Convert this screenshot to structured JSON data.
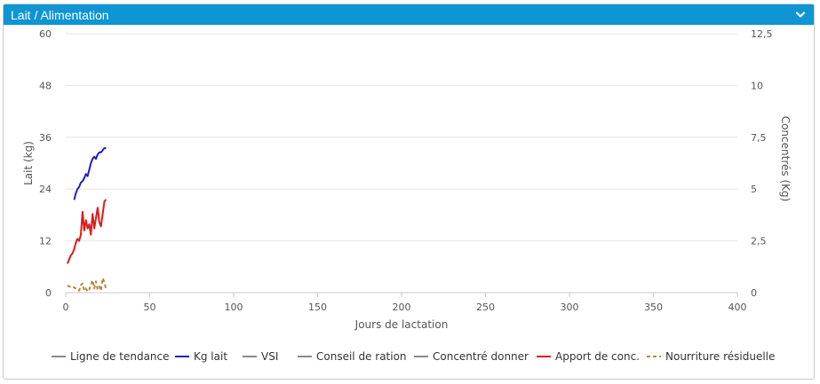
{
  "panel": {
    "title": "Lait / Alimentation"
  },
  "colors": {
    "header": "#0e95d3",
    "kg_lait": "#1f1fbf",
    "apport": "#e01a1a",
    "nourriture": "#b08a3a",
    "neutral": "#8a8a8a"
  },
  "chart_data": {
    "type": "line",
    "xlabel": "Jours de lactation",
    "ylabel_left": "Lait (kg)",
    "ylabel_right": "Concentrés (Kg)",
    "xlim": [
      0,
      400
    ],
    "ylim_left": [
      0,
      60
    ],
    "ylim_right": [
      0,
      12.5
    ],
    "x_ticks": [
      "0",
      "50",
      "100",
      "150",
      "200",
      "250",
      "300",
      "350",
      "400"
    ],
    "y_left_ticks": [
      "0",
      "12",
      "24",
      "36",
      "48",
      "60"
    ],
    "y_right_ticks": [
      "0",
      "2,5",
      "5",
      "7,5",
      "10",
      "12,5"
    ],
    "grid": true,
    "legend_position": "bottom",
    "legend": [
      {
        "name": "Ligne de tendance",
        "color": "#8a8a8a",
        "dash": false
      },
      {
        "name": "Kg lait",
        "color": "#1f1fbf",
        "dash": false
      },
      {
        "name": "VSI",
        "color": "#8a8a8a",
        "dash": false
      },
      {
        "name": "Conseil de ration",
        "color": "#8a8a8a",
        "dash": false
      },
      {
        "name": "Concentré donner",
        "color": "#8a8a8a",
        "dash": false
      },
      {
        "name": "Apport de conc.",
        "color": "#e01a1a",
        "dash": false
      },
      {
        "name": "Nourriture résiduelle",
        "color": "#b08a3a",
        "dash": true
      }
    ],
    "series": [
      {
        "name": "Kg lait",
        "axis": "left",
        "x": [
          5,
          6,
          7,
          8,
          9,
          10,
          11,
          12,
          13,
          14,
          15,
          16,
          17,
          18,
          19,
          20,
          21,
          22,
          23,
          24
        ],
        "y": [
          21.5,
          23,
          24,
          24.5,
          25.5,
          25.8,
          26.5,
          27.5,
          27,
          28.5,
          30,
          31,
          31.5,
          31,
          32,
          32.5,
          32.5,
          33,
          33.5,
          33.5
        ]
      },
      {
        "name": "Apport de conc.",
        "axis": "right",
        "x": [
          1,
          2,
          3,
          4,
          5,
          6,
          7,
          8,
          9,
          10,
          11,
          12,
          13,
          14,
          15,
          16,
          17,
          18,
          19,
          20,
          21,
          22,
          23,
          24
        ],
        "y": [
          1.4,
          1.6,
          1.8,
          1.9,
          2.1,
          2.4,
          2.6,
          2.5,
          2.8,
          3.9,
          3.0,
          3.5,
          3.1,
          3.3,
          2.8,
          3.8,
          3.1,
          3.6,
          4.1,
          3.4,
          3.2,
          3.8,
          4.4,
          4.5
        ]
      },
      {
        "name": "Nourriture résiduelle",
        "axis": "right",
        "x": [
          1,
          2,
          3,
          4,
          5,
          6,
          7,
          8,
          9,
          10,
          11,
          12,
          13,
          14,
          15,
          16,
          17,
          18,
          19,
          20,
          21,
          22,
          23,
          24
        ],
        "y": [
          0.35,
          0.3,
          0.28,
          0.3,
          0.25,
          0.2,
          0.15,
          0.1,
          0.35,
          0.45,
          0.1,
          0.2,
          0.05,
          0.15,
          0.4,
          0.6,
          0.2,
          0.55,
          0.15,
          0.3,
          0.1,
          0.7,
          0.5,
          0.15
        ]
      }
    ]
  }
}
